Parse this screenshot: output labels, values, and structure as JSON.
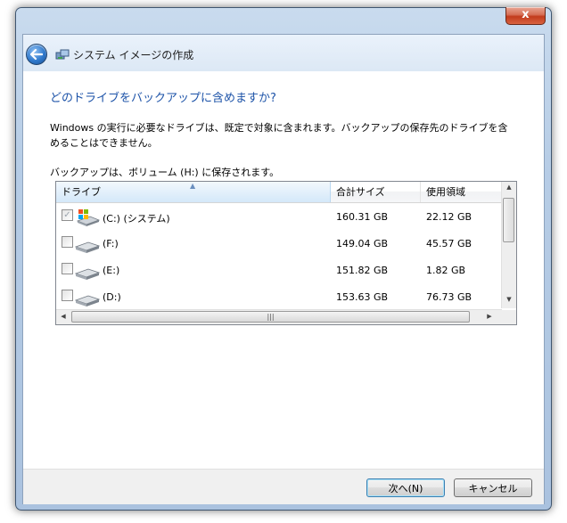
{
  "window": {
    "title": "システム イメージの作成",
    "close_glyph": "x"
  },
  "heading": "どのドライブをバックアップに含めますか?",
  "description": "Windows の実行に必要なドライブは、既定で対象に含まれます。バックアップの保存先のドライブを含めることはできません。",
  "save_info": "バックアップは、ボリューム (H:) に保存されます。",
  "table": {
    "columns": [
      "ドライブ",
      "合計サイズ",
      "使用領域"
    ],
    "sort_column": "ドライブ",
    "rows": [
      {
        "name": "(C:) (システム)",
        "total": "160.31 GB",
        "used": "22.12 GB",
        "checked": true,
        "disabled": true,
        "icon": "windows-drive-icon"
      },
      {
        "name": "(F:)",
        "total": "149.04 GB",
        "used": "45.57 GB",
        "checked": false,
        "disabled": false,
        "icon": "hard-drive-icon"
      },
      {
        "name": "(E:)",
        "total": "151.82 GB",
        "used": "1.82 GB",
        "checked": false,
        "disabled": false,
        "icon": "hard-drive-icon"
      },
      {
        "name": "(D:)",
        "total": "153.63 GB",
        "used": "76.73 GB",
        "checked": false,
        "disabled": false,
        "icon": "hard-drive-icon"
      }
    ]
  },
  "buttons": {
    "next": "次へ(N)",
    "cancel": "キャンセル"
  },
  "colors": {
    "heading": "#1d53a8",
    "frame": "#b7cde6",
    "close": "#c23b1d"
  }
}
